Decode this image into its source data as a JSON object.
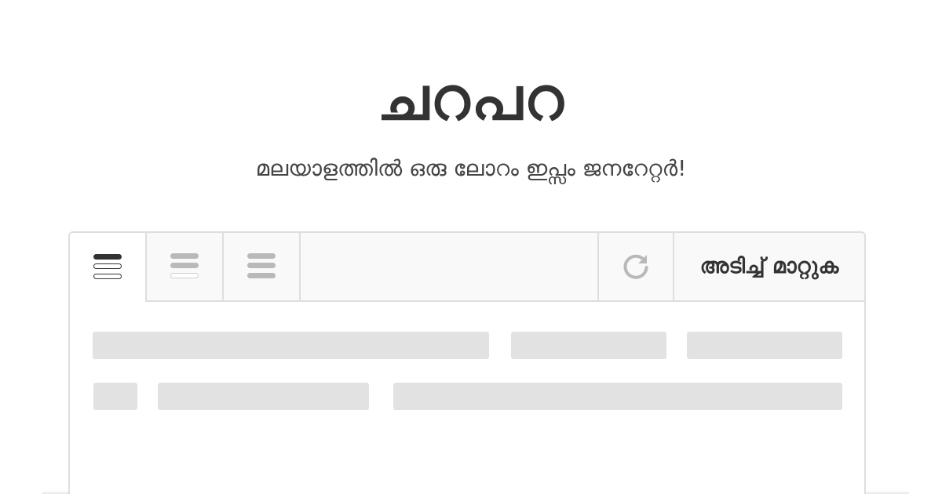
{
  "header": {
    "title": "ചറപറ",
    "subtitle": "മലയാളത്തിൽ ഒരു ലോറം ഇപ്സം ജനറേറ്റർ!"
  },
  "toolbar": {
    "modes": [
      {
        "icon": "paragraph-mode-icon",
        "active": true
      },
      {
        "icon": "sentence-mode-icon",
        "active": false
      },
      {
        "icon": "word-mode-icon",
        "active": false
      }
    ],
    "refresh_icon": "refresh-icon",
    "apply_label": "അടിച്ച് മാറ്റുക"
  },
  "colors": {
    "text": "#333333",
    "placeholder": "#e2e2e2",
    "border": "#dedede",
    "toolbar_bg": "#f9f9f9",
    "icon_active": "#333333",
    "icon_inactive": "#b9b9b9"
  }
}
